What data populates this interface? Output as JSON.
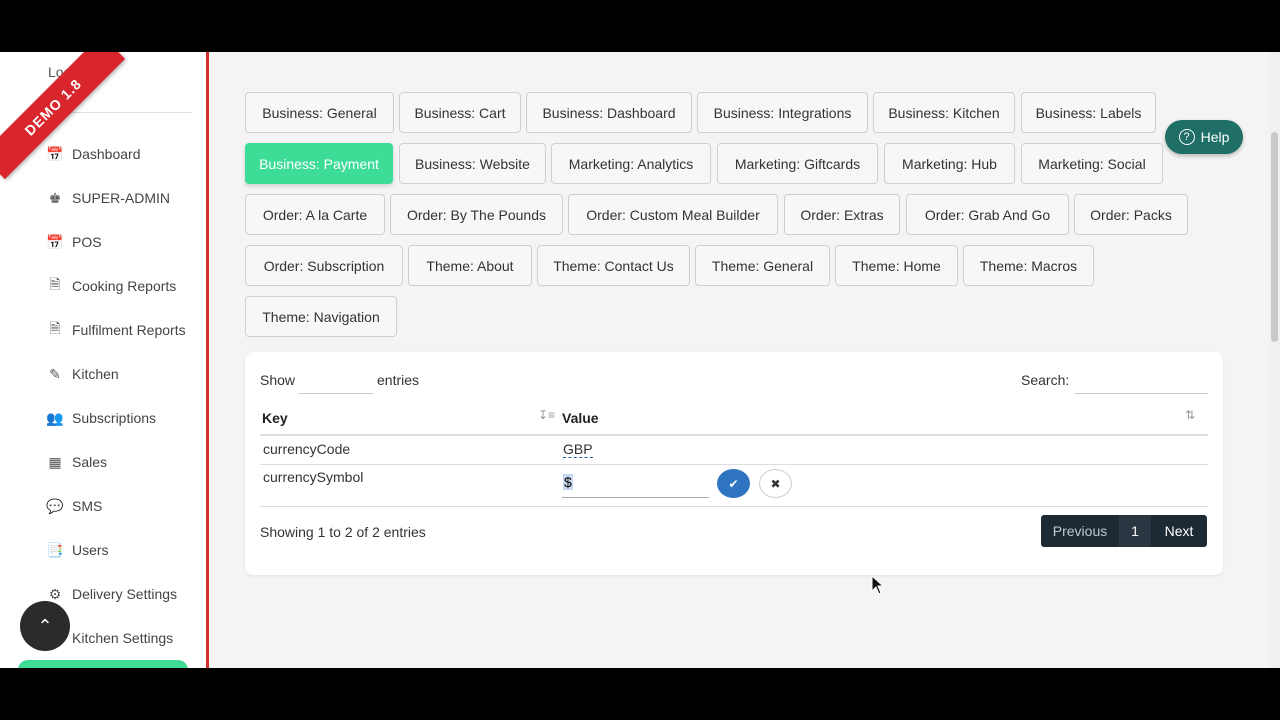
{
  "sidebar": {
    "ribbon": "DEMO 1.8",
    "logout": "Logout",
    "items": [
      {
        "label": "Dashboard",
        "icon": "calendar-icon"
      },
      {
        "label": "SUPER-ADMIN",
        "icon": "crown-icon"
      },
      {
        "label": "POS",
        "icon": "calendar-icon"
      },
      {
        "label": "Cooking Reports",
        "icon": "document-icon"
      },
      {
        "label": "Fulfilment Reports",
        "icon": "document-icon"
      },
      {
        "label": "Kitchen",
        "icon": "carrot-icon"
      },
      {
        "label": "Subscriptions",
        "icon": "users-icon"
      },
      {
        "label": "Sales",
        "icon": "cash-register-icon"
      },
      {
        "label": "SMS",
        "icon": "chat-icon"
      },
      {
        "label": "Users",
        "icon": "address-book-icon"
      },
      {
        "label": "Delivery Settings",
        "icon": "cogs-icon"
      },
      {
        "label": "Kitchen Settings",
        "icon": "cogs-icon"
      }
    ]
  },
  "tabs": [
    "Business: General",
    "Business: Cart",
    "Business: Dashboard",
    "Business: Integrations",
    "Business: Kitchen",
    "Business: Labels",
    "Business: Payment",
    "Business: Website",
    "Marketing: Analytics",
    "Marketing: Giftcards",
    "Marketing: Hub",
    "Marketing: Social",
    "Order: A la Carte",
    "Order: By The Pounds",
    "Order: Custom Meal Builder",
    "Order: Extras",
    "Order: Grab And Go",
    "Order: Packs",
    "Order: Subscription",
    "Theme: About",
    "Theme: Contact Us",
    "Theme: General",
    "Theme: Home",
    "Theme: Macros",
    "Theme: Navigation"
  ],
  "active_tab": "Business: Payment",
  "help_label": "Help",
  "table": {
    "show_label": "Show",
    "entries_label": "entries",
    "search_label": "Search:",
    "headers": {
      "key": "Key",
      "value": "Value"
    },
    "rows": [
      {
        "key": "currencyCode",
        "value": "GBP"
      },
      {
        "key": "currencySymbol",
        "value": "$"
      }
    ],
    "info": "Showing 1 to 2 of 2 entries",
    "pagination": {
      "previous": "Previous",
      "page": "1",
      "next": "Next"
    }
  }
}
